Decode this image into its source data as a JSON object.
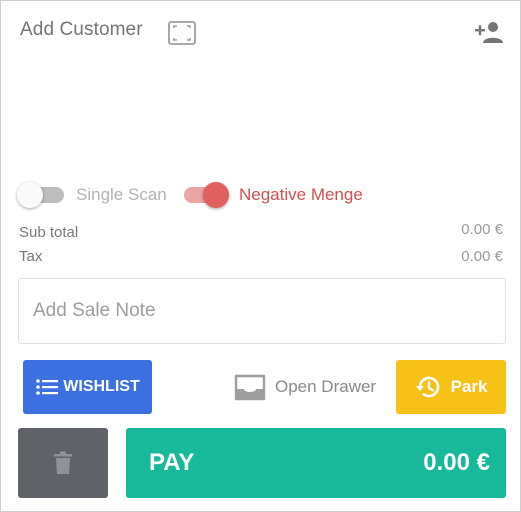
{
  "header": {
    "add_customer_label": "Add Customer",
    "icons": [
      "scan-frame-icon",
      "person-add-icon"
    ]
  },
  "toggles": {
    "single_scan": {
      "label": "Single Scan",
      "on": false
    },
    "negative_menge": {
      "label": "Negative Menge",
      "on": true
    }
  },
  "totals": {
    "subtotal_label": "Sub total",
    "subtotal_value": "0.00 €",
    "tax_label": "Tax",
    "tax_value": "0.00 €"
  },
  "note": {
    "placeholder": "Add Sale Note",
    "value": ""
  },
  "actions": {
    "wishlist_label": "WISHLIST",
    "open_drawer_label": "Open Drawer",
    "park_label": "Park",
    "pay_label": "PAY",
    "pay_amount": "0.00 €"
  },
  "colors": {
    "wishlist": "#3c6fe0",
    "park": "#f8c118",
    "trash": "#5f6368",
    "pay": "#17b99a",
    "negative_accent": "#d64f4f"
  }
}
